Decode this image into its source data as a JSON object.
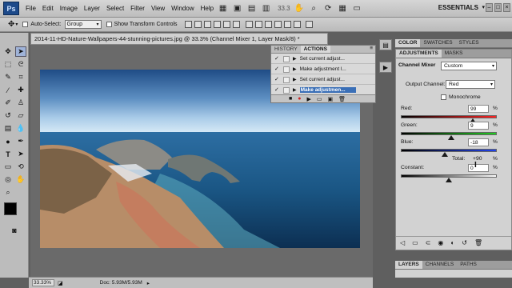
{
  "app": {
    "logo": "Ps"
  },
  "menu": [
    "File",
    "Edit",
    "Image",
    "Layer",
    "Select",
    "Filter",
    "View",
    "Window",
    "Help"
  ],
  "menubar": {
    "zoom": "33.3",
    "workspace": "ESSENTIALS"
  },
  "options": {
    "auto_select_label": "Auto-Select:",
    "auto_select_value": "Group",
    "show_transform_label": "Show Transform Controls"
  },
  "document": {
    "tab_title": "2014-11-HD-Nature-Wallpapers-44-stunning-pictures.jpg @ 33.3% (Channel Mixer 1, Layer Mask/8) *"
  },
  "status": {
    "zoom": "33.33%",
    "doc": "Doc: 5.93M/5.93M"
  },
  "history_panel": {
    "tabs": [
      "HISTORY",
      "ACTIONS"
    ],
    "actions": [
      "Set current adjust...",
      "Make adjustment l...",
      "Set current adjust...",
      "Make adjustmen..."
    ]
  },
  "color_tabs": [
    "COLOR",
    "SWATCHES",
    "STYLES"
  ],
  "adjustments": {
    "tabs": [
      "ADJUSTMENTS",
      "MASKS"
    ],
    "panel_name": "Channel Mixer",
    "preset": "Custom",
    "output_channel_label": "Output Channel:",
    "output_channel": "Red",
    "monochrome_label": "Monochrome",
    "red_label": "Red:",
    "red_value": "99",
    "red_level": 99,
    "green_label": "Green:",
    "green_value": "9",
    "green_level": 9,
    "blue_label": "Blue:",
    "blue_value": "-18",
    "blue_level": -18,
    "total_label": "Total:",
    "total_value": "+90",
    "constant_label": "Constant:",
    "constant_value": "0",
    "constant_level": 0,
    "percent": "%"
  },
  "layers_tabs": [
    "LAYERS",
    "CHANNELS",
    "PATHS"
  ],
  "colors": {
    "selection": "#3a6fb7",
    "panel": "#d2d2d2",
    "bg": "#5f5f5f"
  }
}
